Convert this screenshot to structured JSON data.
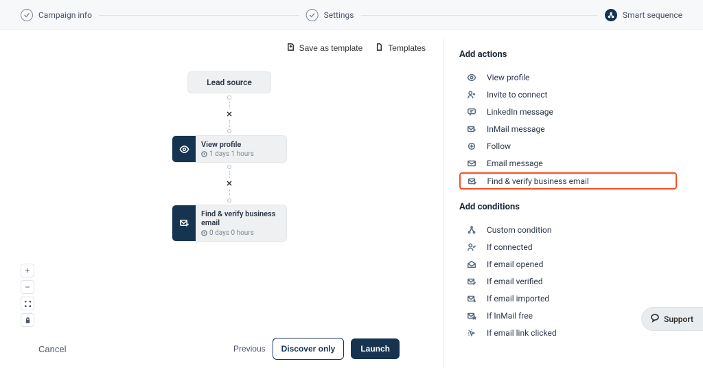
{
  "stepper": {
    "s1": "Campaign info",
    "s2": "Settings",
    "s3": "Smart sequence"
  },
  "toolbar": {
    "save_template": "Save as template",
    "templates": "Templates"
  },
  "canvas": {
    "lead_source": "Lead source",
    "node1": {
      "title": "View profile",
      "delay": "1 days 1 hours"
    },
    "node2": {
      "title": "Find & verify business email",
      "delay": "0 days 0 hours"
    }
  },
  "footer": {
    "cancel": "Cancel",
    "previous": "Previous",
    "discover": "Discover only",
    "launch": "Launch"
  },
  "right": {
    "actions_heading": "Add actions",
    "actions": {
      "view_profile": "View profile",
      "invite": "Invite to connect",
      "li_msg": "LinkedIn message",
      "inmail": "InMail message",
      "follow": "Follow",
      "email_msg": "Email message",
      "find_verify": "Find & verify business email"
    },
    "conditions_heading": "Add conditions",
    "conditions": {
      "custom": "Custom condition",
      "if_connected": "If connected",
      "if_email_opened": "If email opened",
      "if_email_verified": "If email verified",
      "if_email_imported": "If email imported",
      "if_inmail_free": "If InMail free",
      "if_email_clicked": "If email link clicked"
    }
  },
  "support": "Support"
}
